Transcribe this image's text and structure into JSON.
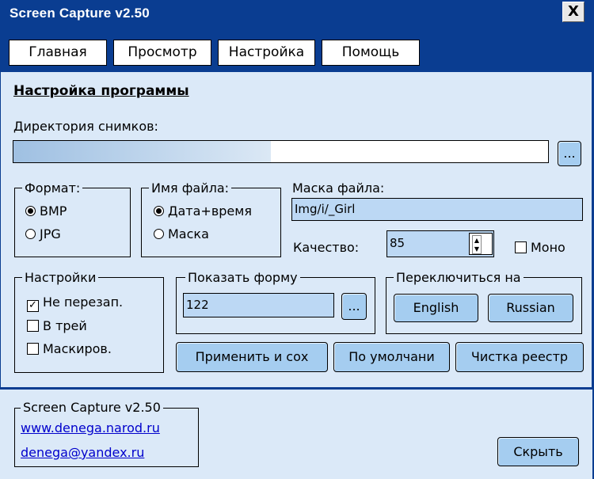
{
  "window": {
    "title": "Screen Capture v2.50",
    "close_label": "X"
  },
  "tabs": [
    "Главная",
    "Просмотр",
    "Настройка",
    "Помощь"
  ],
  "settings": {
    "heading": "Настройка программы",
    "dir_label": "Директория снимков:",
    "dir_browse": "...",
    "format": {
      "legend": "Формат:",
      "options": [
        "BMP",
        "JPG"
      ],
      "selected": "BMP"
    },
    "filename": {
      "legend": "Имя файла:",
      "options": [
        "Дата+время",
        "Маска"
      ],
      "selected": "Дата+время"
    },
    "mask": {
      "label": "Маска файла:",
      "value": "Img/i/_Girl"
    },
    "quality": {
      "label": "Качество:",
      "value": "85"
    },
    "mono": {
      "label": "Моно",
      "checked": false
    },
    "options": {
      "legend": "Настройки",
      "items": [
        {
          "label": "Не перезап.",
          "checked": true
        },
        {
          "label": "В трей",
          "checked": false
        },
        {
          "label": "Маскиров.",
          "checked": false
        }
      ]
    },
    "showform": {
      "legend": "Показать форму",
      "value": "122",
      "browse": "..."
    },
    "language": {
      "legend": "Переключиться на",
      "buttons": [
        "English",
        "Russian"
      ]
    },
    "actions": [
      "Применить и сох",
      "По умолчани",
      "Чистка реестр"
    ]
  },
  "footer": {
    "legend": "Screen Capture v2.50",
    "site": "www.denega.narod.ru",
    "email": "denega@yandex.ru",
    "hide_button": "Скрыть"
  },
  "colors": {
    "titlebar": "#0a3d91",
    "panel": "#dbe9f8",
    "button": "#a5cdf0",
    "input": "#bcd8f4",
    "link": "#0000cc"
  }
}
